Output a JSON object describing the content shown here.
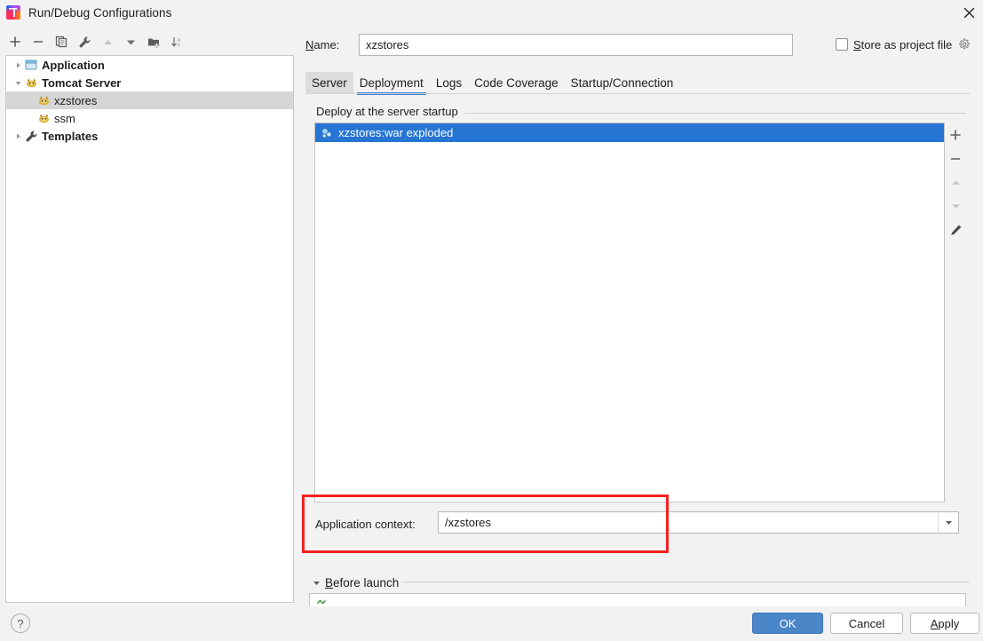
{
  "window": {
    "title": "Run/Debug Configurations",
    "app_icon": "intellij-idea-logo",
    "close_icon": "close-icon"
  },
  "left_toolbar": {
    "buttons": [
      {
        "name": "add-configuration-button",
        "icon": "plus-icon",
        "label": "+"
      },
      {
        "name": "remove-configuration-button",
        "icon": "minus-icon",
        "label": "−"
      },
      {
        "name": "copy-configuration-button",
        "icon": "copy-icon",
        "label": "Copy Configuration"
      },
      {
        "name": "edit-templates-button",
        "icon": "wrench-icon",
        "label": "Edit Templates"
      },
      {
        "name": "move-up-button",
        "icon": "arrow-up-icon",
        "label": "Move Up"
      },
      {
        "name": "move-down-button",
        "icon": "arrow-down-icon",
        "label": "Move Down"
      },
      {
        "name": "move-into-folder-button",
        "icon": "folder-add-icon",
        "label": "Move into new folder"
      },
      {
        "name": "sort-configurations-button",
        "icon": "sort-alpha-icon",
        "label": "Sort Configurations"
      }
    ]
  },
  "tree": {
    "items": [
      {
        "label": "Application",
        "icon": "application-icon",
        "expanded": false,
        "has_toggle": true,
        "level": 0,
        "bold": true,
        "selected": false
      },
      {
        "label": "Tomcat Server",
        "icon": "tomcat-icon",
        "expanded": true,
        "has_toggle": true,
        "level": 0,
        "bold": true,
        "selected": false
      },
      {
        "label": "xzstores",
        "icon": "tomcat-icon",
        "expanded": false,
        "has_toggle": false,
        "level": 1,
        "bold": false,
        "selected": true
      },
      {
        "label": "ssm",
        "icon": "tomcat-icon",
        "expanded": false,
        "has_toggle": false,
        "level": 1,
        "bold": false,
        "selected": false
      },
      {
        "label": "Templates",
        "icon": "wrench-icon",
        "expanded": false,
        "has_toggle": true,
        "level": 0,
        "bold": true,
        "selected": false
      }
    ]
  },
  "header": {
    "name_label_prefix": "N",
    "name_label_rest": "ame:",
    "name_value": "xzstores",
    "name_placeholder": "",
    "store_checkbox_checked": false,
    "store_label_prefix": "S",
    "store_label_rest": "tore as project file",
    "store_gear_icon": "gear-icon"
  },
  "tabs": [
    {
      "label": "Server",
      "active": false,
      "hovered": true
    },
    {
      "label": "Deployment",
      "active": true,
      "hovered": false
    },
    {
      "label": "Logs",
      "active": false,
      "hovered": false
    },
    {
      "label": "Code Coverage",
      "active": false,
      "hovered": false
    },
    {
      "label": "Startup/Connection",
      "active": false,
      "hovered": false
    }
  ],
  "deployment": {
    "group_title": "Deploy at the server startup",
    "rows": [
      {
        "label": "xzstores:war exploded",
        "icon": "artifact-icon",
        "selected": true
      }
    ],
    "side_buttons": [
      {
        "name": "add-artifact-button",
        "icon": "plus-icon",
        "label": "+"
      },
      {
        "name": "remove-artifact-button",
        "icon": "minus-icon",
        "label": "−"
      },
      {
        "name": "move-artifact-up-button",
        "icon": "arrow-up-icon",
        "label": "Move Up"
      },
      {
        "name": "move-artifact-down-button",
        "icon": "arrow-down-icon",
        "label": "Move Down"
      },
      {
        "name": "edit-artifact-button",
        "icon": "pencil-icon",
        "label": "Edit"
      }
    ],
    "app_context_label": "Application context:",
    "app_context_value": "/xzstores",
    "app_context_placeholder": "",
    "app_context_arrow_icon": "chevron-down-icon"
  },
  "before_launch": {
    "arrow_icon": "triangle-down-icon",
    "label_prefix": "B",
    "label_rest": "efore launch",
    "item_icon": "build-icon"
  },
  "footer": {
    "help_label": "?",
    "ok_label": "OK",
    "cancel_label": "Cancel",
    "apply_label_prefix": "A",
    "apply_label_rest": "pply"
  },
  "colors": {
    "accent_blue": "#2675d4",
    "tab_underline": "#3c7fd4",
    "ok_button": "#4a86c8",
    "annotation_red": "#f42121",
    "dialog_bg": "#f2f2f2",
    "selection_gray": "#d6d6d6"
  }
}
